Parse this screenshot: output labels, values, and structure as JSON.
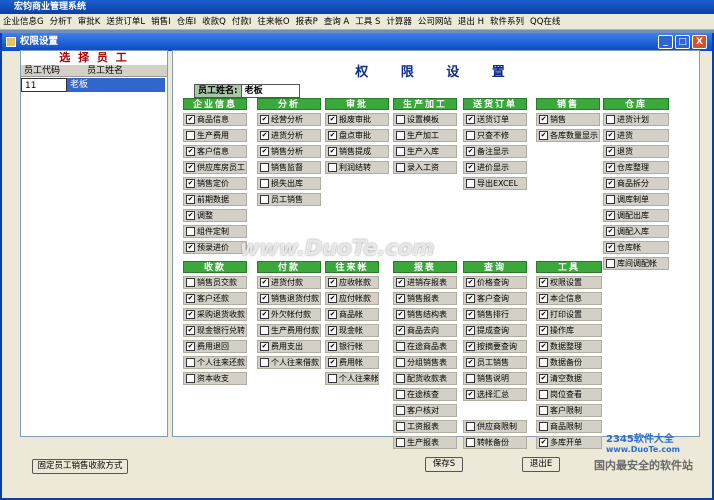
{
  "app_title": "宏钧商业管理系统",
  "menu": [
    "企业信息G",
    "分析T",
    "审批K",
    "送货订单L",
    "销售I",
    "仓库I",
    "收款Q",
    "付款I",
    "往来帐O",
    "报表P",
    "查询 A",
    "工具 S",
    "计算器",
    "公司网站",
    "退出 H",
    "软件系列",
    "QQ在线"
  ],
  "window_title": "权限设置",
  "window_buttons": {
    "min": "_",
    "max": "□",
    "close": "X"
  },
  "left_panel": {
    "title": "选 择 员 工",
    "columns": [
      "员工代码",
      "员工姓名"
    ],
    "rows": [
      {
        "code": "11",
        "name": "老板"
      }
    ]
  },
  "right_title": "权 限 设 置",
  "employee": {
    "label": "员工姓名:",
    "value": "老板"
  },
  "groups": [
    {
      "name": "企业信息",
      "items": [
        {
          "t": "商品信息",
          "c": true
        },
        {
          "t": "生产费用",
          "c": false
        },
        {
          "t": "客户信息",
          "c": true
        },
        {
          "t": "供应库房员工",
          "c": true
        },
        {
          "t": "销售定价",
          "c": true
        },
        {
          "t": "前期数据",
          "c": true
        },
        {
          "t": "调整",
          "c": true
        },
        {
          "t": "组件定制",
          "c": false
        },
        {
          "t": "预录进价",
          "c": true
        }
      ]
    },
    {
      "name": "分析",
      "items": [
        {
          "t": "经营分析",
          "c": true
        },
        {
          "t": "进货分析",
          "c": true
        },
        {
          "t": "销售分析",
          "c": true
        },
        {
          "t": "销售监督",
          "c": false
        },
        {
          "t": "损失出库",
          "c": false
        },
        {
          "t": "员工销售",
          "c": false
        }
      ]
    },
    {
      "name": "审批",
      "items": [
        {
          "t": "报废审批",
          "c": true
        },
        {
          "t": "盘点审批",
          "c": true
        },
        {
          "t": "销售提成",
          "c": true
        },
        {
          "t": "利润结转",
          "c": false
        }
      ]
    },
    {
      "name": "生产加工",
      "items": [
        {
          "t": "设置模板",
          "c": false
        },
        {
          "t": "生产加工",
          "c": false
        },
        {
          "t": "生产入库",
          "c": false
        },
        {
          "t": "录入工资",
          "c": false
        }
      ]
    },
    {
      "name": "送货订单",
      "items": [
        {
          "t": "送货订单",
          "c": true
        },
        {
          "t": "只查不修",
          "c": false
        },
        {
          "t": "备注显示",
          "c": true
        },
        {
          "t": "进价显示",
          "c": true
        },
        {
          "t": "导出EXCEL",
          "c": false
        }
      ]
    },
    {
      "name": "销售",
      "items": [
        {
          "t": "销售",
          "c": true
        },
        {
          "t": "各库数量显示",
          "c": true
        }
      ]
    },
    {
      "name": "仓库",
      "items": [
        {
          "t": "进货计划",
          "c": false
        },
        {
          "t": "进货",
          "c": true
        },
        {
          "t": "退货",
          "c": true
        },
        {
          "t": "仓库整理",
          "c": true
        },
        {
          "t": "商品拆分",
          "c": true
        },
        {
          "t": "调库制单",
          "c": false
        },
        {
          "t": "调配出库",
          "c": true
        },
        {
          "t": "调配入库",
          "c": true
        },
        {
          "t": "仓库帐",
          "c": true
        },
        {
          "t": "库间调配帐",
          "c": false
        }
      ]
    },
    {
      "name": "收款",
      "items": [
        {
          "t": "销售员交款",
          "c": false
        },
        {
          "t": "客户还款",
          "c": true
        },
        {
          "t": "采购退货收款",
          "c": true
        },
        {
          "t": "现金银行兑转",
          "c": true
        },
        {
          "t": "费用退回",
          "c": true
        },
        {
          "t": "个人往来还款",
          "c": false
        },
        {
          "t": "资本收支",
          "c": false
        }
      ]
    },
    {
      "name": "付款",
      "items": [
        {
          "t": "进货付款",
          "c": true
        },
        {
          "t": "销售退货付款",
          "c": true
        },
        {
          "t": "外欠帐付款",
          "c": true
        },
        {
          "t": "生产费用付款",
          "c": false
        },
        {
          "t": "费用支出",
          "c": true
        },
        {
          "t": "个人往来借款",
          "c": false
        }
      ]
    },
    {
      "name": "往来帐",
      "items": [
        {
          "t": "应收帐款",
          "c": true
        },
        {
          "t": "应付帐款",
          "c": true
        },
        {
          "t": "商品帐",
          "c": true
        },
        {
          "t": "现金帐",
          "c": true
        },
        {
          "t": "银行帐",
          "c": true
        },
        {
          "t": "费用帐",
          "c": true
        },
        {
          "t": "个人往来帐",
          "c": false
        }
      ]
    },
    {
      "name": "报表",
      "items": [
        {
          "t": "进销存报表",
          "c": true
        },
        {
          "t": "销售报表",
          "c": true
        },
        {
          "t": "销售结构表",
          "c": true
        },
        {
          "t": "商品去向",
          "c": true
        },
        {
          "t": "在途商品表",
          "c": false
        },
        {
          "t": "分组销售表",
          "c": false
        },
        {
          "t": "配货收款表",
          "c": false
        },
        {
          "t": "在途核查",
          "c": false
        },
        {
          "t": "客户核对",
          "c": false
        },
        {
          "t": "工资报表",
          "c": false
        },
        {
          "t": "生产报表",
          "c": false
        }
      ]
    },
    {
      "name": "查询",
      "items": [
        {
          "t": "价格查询",
          "c": true
        },
        {
          "t": "客户查询",
          "c": true
        },
        {
          "t": "销售排行",
          "c": true
        },
        {
          "t": "提成查询",
          "c": true
        },
        {
          "t": "按摘要查询",
          "c": true
        },
        {
          "t": "员工销售",
          "c": true
        },
        {
          "t": "销售说明",
          "c": false
        },
        {
          "t": "选择汇总",
          "c": true
        },
        {
          "t": "",
          "c": false
        },
        {
          "t": "供应商限制",
          "c": false
        },
        {
          "t": "转帐备份",
          "c": false
        }
      ]
    },
    {
      "name": "工具",
      "items": [
        {
          "t": "权限设置",
          "c": true
        },
        {
          "t": "本企信息",
          "c": true
        },
        {
          "t": "打印设置",
          "c": true
        },
        {
          "t": "操作库",
          "c": true
        },
        {
          "t": "数据整理",
          "c": true
        },
        {
          "t": "数据备份",
          "c": false
        },
        {
          "t": "清空数据",
          "c": true
        },
        {
          "t": "岗位查看",
          "c": false
        },
        {
          "t": "客户限制",
          "c": false
        },
        {
          "t": "商品限制",
          "c": false
        },
        {
          "t": "多库开单",
          "c": true
        }
      ]
    }
  ],
  "buttons": {
    "fixed": "固定员工销售收款方式",
    "save": "保存S",
    "exit": "退出E"
  },
  "watermark": "www.DuoTe.com",
  "logo": {
    "line1": "2345软件大全",
    "line2": "国内最安全的软件站",
    "url": "www.DuoTe.com"
  }
}
